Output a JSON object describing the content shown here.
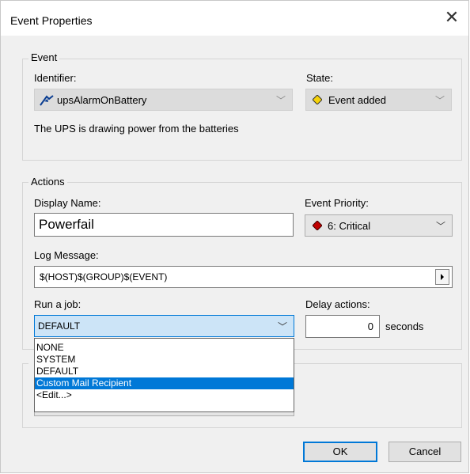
{
  "window": {
    "title": "Event Properties",
    "close_glyph": "✕"
  },
  "event_group": {
    "label": "Event",
    "identifier_label": "Identifier:",
    "identifier_value": "upsAlarmOnBattery",
    "identifier_icon": "event-flag-icon",
    "state_label": "State:",
    "state_value": "Event added",
    "state_icon": "yellow-diamond-icon",
    "description": "The UPS is drawing power from the batteries"
  },
  "actions_group": {
    "label": "Actions",
    "display_name_label": "Display Name:",
    "display_name_value": "Powerfail",
    "event_priority_label": "Event Priority:",
    "event_priority_value": "6: Critical",
    "event_priority_icon": "red-diamond-icon",
    "log_message_label": "Log Message:",
    "log_message_value": "$(HOST)$(GROUP)$(EVENT)",
    "run_job_label": "Run a job:",
    "run_job_value": "DEFAULT",
    "run_job_options": [
      "NONE",
      "SYSTEM",
      "DEFAULT",
      "Custom Mail Recipient",
      "<Edit...>"
    ],
    "run_job_highlighted": "Custom Mail Recipient",
    "delay_label": "Delay actions:",
    "delay_value": "0",
    "delay_unit": "seconds"
  },
  "buttons": {
    "ok": "OK",
    "cancel": "Cancel"
  },
  "colors": {
    "selection": "#0078d7",
    "dialog_bg": "#f0f0f0",
    "priority_diamond": "#c00000",
    "state_diamond": "#f5d20a"
  }
}
